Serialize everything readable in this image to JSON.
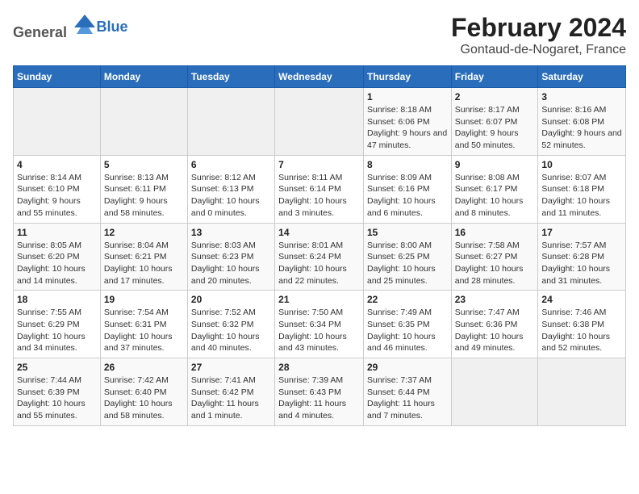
{
  "header": {
    "logo_general": "General",
    "logo_blue": "Blue",
    "title": "February 2024",
    "subtitle": "Gontaud-de-Nogaret, France"
  },
  "days_of_week": [
    "Sunday",
    "Monday",
    "Tuesday",
    "Wednesday",
    "Thursday",
    "Friday",
    "Saturday"
  ],
  "weeks": [
    [
      {
        "day": "",
        "detail": ""
      },
      {
        "day": "",
        "detail": ""
      },
      {
        "day": "",
        "detail": ""
      },
      {
        "day": "",
        "detail": ""
      },
      {
        "day": "1",
        "detail": "Sunrise: 8:18 AM\nSunset: 6:06 PM\nDaylight: 9 hours and 47 minutes."
      },
      {
        "day": "2",
        "detail": "Sunrise: 8:17 AM\nSunset: 6:07 PM\nDaylight: 9 hours and 50 minutes."
      },
      {
        "day": "3",
        "detail": "Sunrise: 8:16 AM\nSunset: 6:08 PM\nDaylight: 9 hours and 52 minutes."
      }
    ],
    [
      {
        "day": "4",
        "detail": "Sunrise: 8:14 AM\nSunset: 6:10 PM\nDaylight: 9 hours and 55 minutes."
      },
      {
        "day": "5",
        "detail": "Sunrise: 8:13 AM\nSunset: 6:11 PM\nDaylight: 9 hours and 58 minutes."
      },
      {
        "day": "6",
        "detail": "Sunrise: 8:12 AM\nSunset: 6:13 PM\nDaylight: 10 hours and 0 minutes."
      },
      {
        "day": "7",
        "detail": "Sunrise: 8:11 AM\nSunset: 6:14 PM\nDaylight: 10 hours and 3 minutes."
      },
      {
        "day": "8",
        "detail": "Sunrise: 8:09 AM\nSunset: 6:16 PM\nDaylight: 10 hours and 6 minutes."
      },
      {
        "day": "9",
        "detail": "Sunrise: 8:08 AM\nSunset: 6:17 PM\nDaylight: 10 hours and 8 minutes."
      },
      {
        "day": "10",
        "detail": "Sunrise: 8:07 AM\nSunset: 6:18 PM\nDaylight: 10 hours and 11 minutes."
      }
    ],
    [
      {
        "day": "11",
        "detail": "Sunrise: 8:05 AM\nSunset: 6:20 PM\nDaylight: 10 hours and 14 minutes."
      },
      {
        "day": "12",
        "detail": "Sunrise: 8:04 AM\nSunset: 6:21 PM\nDaylight: 10 hours and 17 minutes."
      },
      {
        "day": "13",
        "detail": "Sunrise: 8:03 AM\nSunset: 6:23 PM\nDaylight: 10 hours and 20 minutes."
      },
      {
        "day": "14",
        "detail": "Sunrise: 8:01 AM\nSunset: 6:24 PM\nDaylight: 10 hours and 22 minutes."
      },
      {
        "day": "15",
        "detail": "Sunrise: 8:00 AM\nSunset: 6:25 PM\nDaylight: 10 hours and 25 minutes."
      },
      {
        "day": "16",
        "detail": "Sunrise: 7:58 AM\nSunset: 6:27 PM\nDaylight: 10 hours and 28 minutes."
      },
      {
        "day": "17",
        "detail": "Sunrise: 7:57 AM\nSunset: 6:28 PM\nDaylight: 10 hours and 31 minutes."
      }
    ],
    [
      {
        "day": "18",
        "detail": "Sunrise: 7:55 AM\nSunset: 6:29 PM\nDaylight: 10 hours and 34 minutes."
      },
      {
        "day": "19",
        "detail": "Sunrise: 7:54 AM\nSunset: 6:31 PM\nDaylight: 10 hours and 37 minutes."
      },
      {
        "day": "20",
        "detail": "Sunrise: 7:52 AM\nSunset: 6:32 PM\nDaylight: 10 hours and 40 minutes."
      },
      {
        "day": "21",
        "detail": "Sunrise: 7:50 AM\nSunset: 6:34 PM\nDaylight: 10 hours and 43 minutes."
      },
      {
        "day": "22",
        "detail": "Sunrise: 7:49 AM\nSunset: 6:35 PM\nDaylight: 10 hours and 46 minutes."
      },
      {
        "day": "23",
        "detail": "Sunrise: 7:47 AM\nSunset: 6:36 PM\nDaylight: 10 hours and 49 minutes."
      },
      {
        "day": "24",
        "detail": "Sunrise: 7:46 AM\nSunset: 6:38 PM\nDaylight: 10 hours and 52 minutes."
      }
    ],
    [
      {
        "day": "25",
        "detail": "Sunrise: 7:44 AM\nSunset: 6:39 PM\nDaylight: 10 hours and 55 minutes."
      },
      {
        "day": "26",
        "detail": "Sunrise: 7:42 AM\nSunset: 6:40 PM\nDaylight: 10 hours and 58 minutes."
      },
      {
        "day": "27",
        "detail": "Sunrise: 7:41 AM\nSunset: 6:42 PM\nDaylight: 11 hours and 1 minute."
      },
      {
        "day": "28",
        "detail": "Sunrise: 7:39 AM\nSunset: 6:43 PM\nDaylight: 11 hours and 4 minutes."
      },
      {
        "day": "29",
        "detail": "Sunrise: 7:37 AM\nSunset: 6:44 PM\nDaylight: 11 hours and 7 minutes."
      },
      {
        "day": "",
        "detail": ""
      },
      {
        "day": "",
        "detail": ""
      }
    ]
  ]
}
